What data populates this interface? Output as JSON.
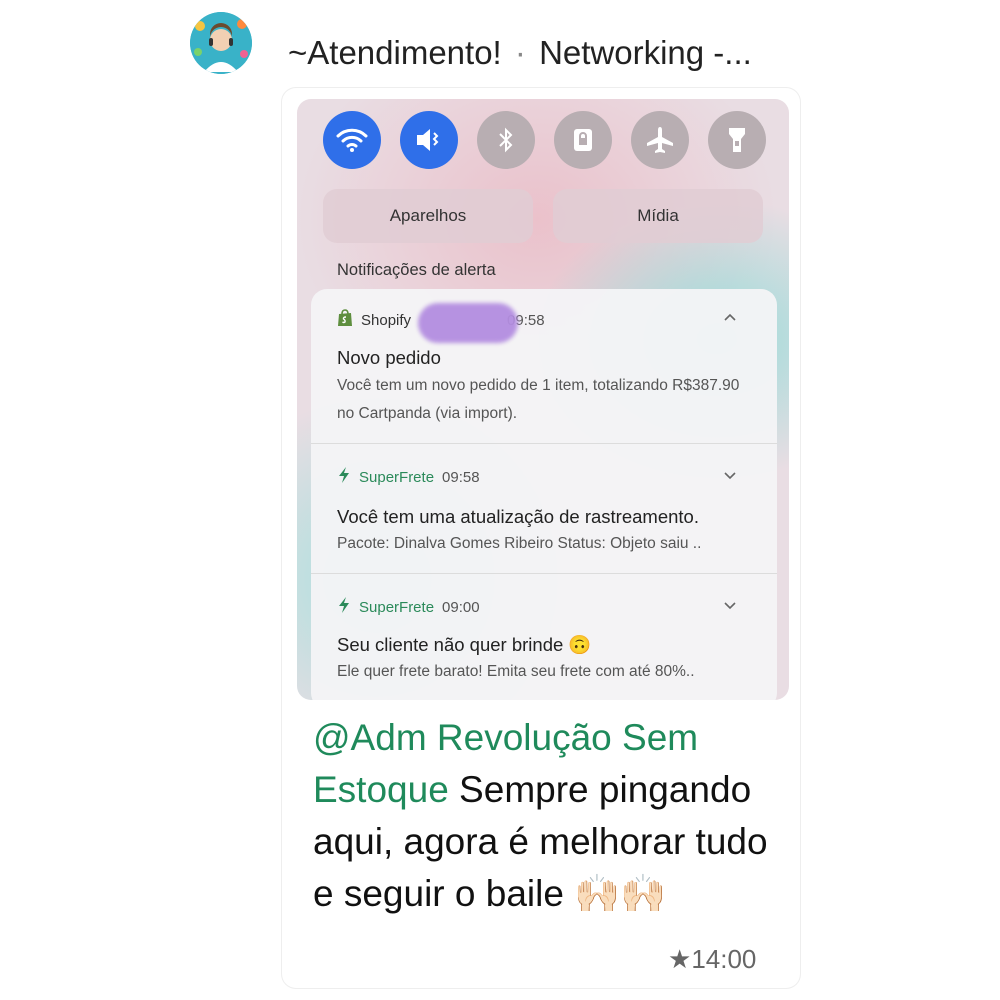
{
  "chat": {
    "title": "~Atendimento!",
    "separator": "·",
    "subtitle": "Networking -..."
  },
  "screenshot": {
    "quick_settings": [
      {
        "icon": "wifi-icon",
        "active": true
      },
      {
        "icon": "mute-icon",
        "active": true
      },
      {
        "icon": "bluetooth-icon",
        "active": false
      },
      {
        "icon": "lock-screen-icon",
        "active": false
      },
      {
        "icon": "airplane-icon",
        "active": false
      },
      {
        "icon": "flashlight-icon",
        "active": false
      }
    ],
    "devices_label": "Aparelhos",
    "media_label": "Mídia",
    "alerts_heading": "Notificações de alerta",
    "notifications": [
      {
        "app": "Shopify",
        "time": "09:58",
        "title": "Novo pedido",
        "body": "Você tem um novo pedido de 1 item, totalizando R$387.90 no Cartpanda (via import).",
        "chevron": "chevron-up-icon"
      },
      {
        "app": "SuperFrete",
        "time": "09:58",
        "title": "Você tem uma atualização de rastreamento.",
        "body": "Pacote: Dinalva Gomes Ribeiro Status: Objeto saiu ..",
        "chevron": "chevron-down-icon"
      },
      {
        "app": "SuperFrete",
        "time": "09:00",
        "title": "Seu cliente não quer brinde 🙃",
        "body": "Ele quer frete barato! Emita seu frete com até 80%..",
        "chevron": "chevron-down-icon"
      }
    ]
  },
  "message": {
    "mention": "@Adm Revolução Sem Estoque",
    "text": " Sempre pingando aqui, agora é melhorar tudo e seguir o baile 🙌🏻🙌🏻",
    "starred_icon": "star-icon",
    "time": "14:00"
  },
  "colors": {
    "accent_blue": "#2f6fe9",
    "mention_green": "#1f8a5b",
    "app_green": "#2b8a5a"
  }
}
